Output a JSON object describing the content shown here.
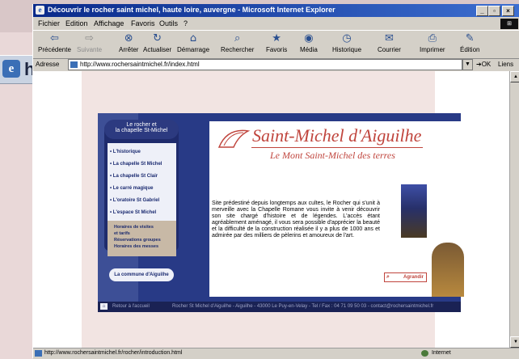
{
  "browser": {
    "title": "Découvrir le rocher saint michel, haute loire, auvergne - Microsoft Internet Explorer",
    "behind_window_text": "ht",
    "menu": [
      "Fichier",
      "Edition",
      "Affichage",
      "Favoris",
      "Outils",
      "?"
    ],
    "toolbar": [
      {
        "label": "Précédente",
        "icon": "back-arrow-icon"
      },
      {
        "label": "Suivante",
        "icon": "forward-arrow-icon"
      },
      {
        "label": "Arrêter",
        "icon": "stop-icon"
      },
      {
        "label": "Actualiser",
        "icon": "refresh-icon"
      },
      {
        "label": "Démarrage",
        "icon": "home-icon"
      },
      {
        "label": "Rechercher",
        "icon": "search-icon"
      },
      {
        "label": "Favoris",
        "icon": "favorites-icon"
      },
      {
        "label": "Média",
        "icon": "media-icon"
      },
      {
        "label": "Historique",
        "icon": "history-icon"
      },
      {
        "label": "Courrier",
        "icon": "mail-icon"
      },
      {
        "label": "Imprimer",
        "icon": "print-icon"
      },
      {
        "label": "Édition",
        "icon": "edit-icon"
      }
    ],
    "address_label": "Adresse",
    "address": "http://www.rochersaintmichel.fr/index.html",
    "go_label": "OK",
    "links_label": "Liens",
    "status_url": "http://www.rochersaintmichel.fr/rocher/introduction.html",
    "status_zone": "Internet"
  },
  "site": {
    "nav_header": [
      "Le rocher et",
      "la chapelle St-Michel"
    ],
    "nav_items": [
      "L'historique",
      "La chapelle St Michel",
      "La chapelle St Clair",
      "Le carré magique",
      "L'oratoire St Gabriel",
      "L'espace St Michel"
    ],
    "nav_box": [
      "Horaires de visites",
      "et tarifs",
      "Réservations groupes",
      "Horaires des messes"
    ],
    "commune_button": "La commune d'Aiguilhe",
    "title": "Saint-Michel d'Aiguilhe",
    "subtitle": "Le Mont Saint-Michel des terres",
    "description": "Site prédestiné depuis longtemps aux cultes, le Rocher qui s'unit à merveille avec la Chapelle Romane vous invite à venir découvrir son site chargé d'histoire et de légendes. L'accès étant agréablement aménagé, il vous sera possible d'apprécier la beauté et la difficulté de la construction réalisée il y a plus de 1000 ans et admirée par des milliers de pèlerins et amoureux de l'art.",
    "agrandir": "Agrandir",
    "footer_left": "Retour à l'accueil",
    "footer_right": "Rocher St Michel d'Aiguilhe - Aiguilhe - 43000 Le Puy-en-Velay - Tel / Fax : 04 71 09 50 03 - contact@rochersaintmichel.fr"
  }
}
